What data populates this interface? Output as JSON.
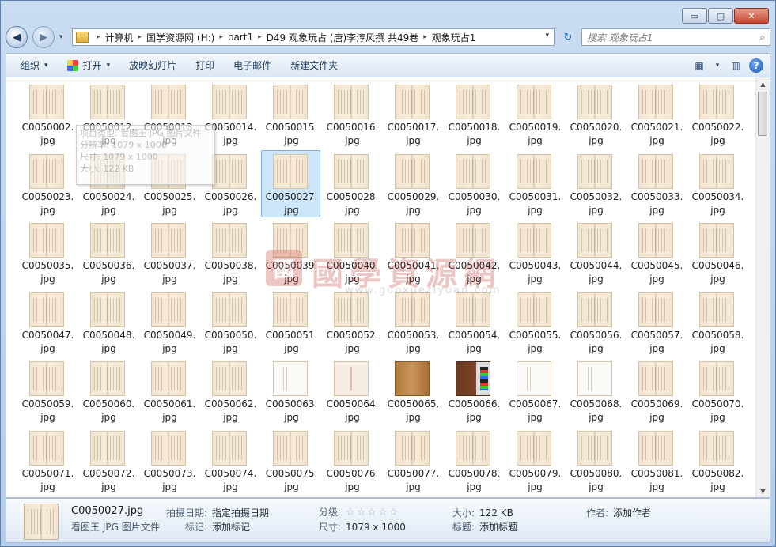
{
  "window": {
    "buttons": {
      "minimize": "▭",
      "maximize": "▢",
      "close": "✕"
    }
  },
  "nav": {
    "back": "◀",
    "forward": "▶",
    "recent": "▾"
  },
  "address": {
    "crumbs": [
      "计算机",
      "国学资源网 (H:)",
      "part1",
      "D49 观象玩占 (唐)李淳风撰 共49卷",
      "观象玩占1"
    ],
    "sep": "▸",
    "dropdown": "▾",
    "refresh": "↻"
  },
  "search": {
    "placeholder": "搜索 观象玩占1",
    "icon": "⌕"
  },
  "toolbar": {
    "organize": "组织",
    "open": "打开",
    "slideshow": "放映幻灯片",
    "print": "打印",
    "email": "电子邮件",
    "new_folder": "新建文件夹",
    "caret": "▾",
    "views_icon": "▦",
    "pane_icon": "▥",
    "help_icon": "?"
  },
  "tooltip": {
    "lines": [
      "项目类型: 看图王 JPG 图片文件",
      "分辨率: 1079 x 1000",
      "尺寸: 1079 x 1000",
      "大小: 122 KB"
    ]
  },
  "watermark": {
    "seal": "國",
    "text": "國學資源網",
    "url": "www.guoxueziyuan.com"
  },
  "files": [
    {
      "name": "C0050002.",
      "ext": "jpg"
    },
    {
      "name": "C0050012.",
      "ext": "jpg"
    },
    {
      "name": "C0050013.",
      "ext": "jpg"
    },
    {
      "name": "C0050014.",
      "ext": "jpg"
    },
    {
      "name": "C0050015.",
      "ext": "jpg"
    },
    {
      "name": "C0050016.",
      "ext": "jpg"
    },
    {
      "name": "C0050017.",
      "ext": "jpg"
    },
    {
      "name": "C0050018.",
      "ext": "jpg"
    },
    {
      "name": "C0050019.",
      "ext": "jpg"
    },
    {
      "name": "C0050020.",
      "ext": "jpg"
    },
    {
      "name": "C0050021.",
      "ext": "jpg"
    },
    {
      "name": "C0050022.",
      "ext": "jpg"
    },
    {
      "name": "C0050023.",
      "ext": "jpg"
    },
    {
      "name": "C0050024.",
      "ext": "jpg"
    },
    {
      "name": "C0050025.",
      "ext": "jpg"
    },
    {
      "name": "C0050026.",
      "ext": "jpg"
    },
    {
      "name": "C0050027.",
      "ext": "jpg"
    },
    {
      "name": "C0050028.",
      "ext": "jpg"
    },
    {
      "name": "C0050029.",
      "ext": "jpg"
    },
    {
      "name": "C0050030.",
      "ext": "jpg"
    },
    {
      "name": "C0050031.",
      "ext": "jpg"
    },
    {
      "name": "C0050032.",
      "ext": "jpg"
    },
    {
      "name": "C0050033.",
      "ext": "jpg"
    },
    {
      "name": "C0050034.",
      "ext": "jpg"
    },
    {
      "name": "C0050035.",
      "ext": "jpg"
    },
    {
      "name": "C0050036.",
      "ext": "jpg"
    },
    {
      "name": "C0050037.",
      "ext": "jpg"
    },
    {
      "name": "C0050038.",
      "ext": "jpg"
    },
    {
      "name": "C0050039.",
      "ext": "jpg"
    },
    {
      "name": "C0050040.",
      "ext": "jpg"
    },
    {
      "name": "C0050041.",
      "ext": "jpg"
    },
    {
      "name": "C0050042.",
      "ext": "jpg"
    },
    {
      "name": "C0050043.",
      "ext": "jpg"
    },
    {
      "name": "C0050044.",
      "ext": "jpg"
    },
    {
      "name": "C0050045.",
      "ext": "jpg"
    },
    {
      "name": "C0050046.",
      "ext": "jpg"
    },
    {
      "name": "C0050047.",
      "ext": "jpg"
    },
    {
      "name": "C0050048.",
      "ext": "jpg"
    },
    {
      "name": "C0050049.",
      "ext": "jpg"
    },
    {
      "name": "C0050050.",
      "ext": "jpg"
    },
    {
      "name": "C0050051.",
      "ext": "jpg"
    },
    {
      "name": "C0050052.",
      "ext": "jpg"
    },
    {
      "name": "C0050053.",
      "ext": "jpg"
    },
    {
      "name": "C0050054.",
      "ext": "jpg"
    },
    {
      "name": "C0050055.",
      "ext": "jpg"
    },
    {
      "name": "C0050056.",
      "ext": "jpg"
    },
    {
      "name": "C0050057.",
      "ext": "jpg"
    },
    {
      "name": "C0050058.",
      "ext": "jpg"
    },
    {
      "name": "C0050059.",
      "ext": "jpg"
    },
    {
      "name": "C0050060.",
      "ext": "jpg"
    },
    {
      "name": "C0050061.",
      "ext": "jpg"
    },
    {
      "name": "C0050062.",
      "ext": "jpg"
    },
    {
      "name": "C0050063.",
      "ext": "jpg"
    },
    {
      "name": "C0050064.",
      "ext": "jpg"
    },
    {
      "name": "C0050065.",
      "ext": "jpg"
    },
    {
      "name": "C0050066.",
      "ext": "jpg"
    },
    {
      "name": "C0050067.",
      "ext": "jpg"
    },
    {
      "name": "C0050068.",
      "ext": "jpg"
    },
    {
      "name": "C0050069.",
      "ext": "jpg"
    },
    {
      "name": "C0050070.",
      "ext": "jpg"
    },
    {
      "name": "C0050071.",
      "ext": "jpg"
    },
    {
      "name": "C0050072.",
      "ext": "jpg"
    },
    {
      "name": "C0050073.",
      "ext": "jpg"
    },
    {
      "name": "C0050074.",
      "ext": "jpg"
    },
    {
      "name": "C0050075.",
      "ext": "jpg"
    },
    {
      "name": "C0050076.",
      "ext": "jpg"
    },
    {
      "name": "C0050077.",
      "ext": "jpg"
    },
    {
      "name": "C0050078.",
      "ext": "jpg"
    },
    {
      "name": "C0050079.",
      "ext": "jpg"
    },
    {
      "name": "C0050080.",
      "ext": "jpg"
    },
    {
      "name": "C0050081.",
      "ext": "jpg"
    },
    {
      "name": "C0050082.",
      "ext": "jpg"
    }
  ],
  "selected_file": "C0050027.",
  "details": {
    "filename": "C0050027.jpg",
    "filetype": "看图王 JPG 图片文件",
    "date_taken_label": "拍摄日期:",
    "date_taken_value": "指定拍摄日期",
    "tags_label": "标记:",
    "tags_value": "添加标记",
    "rating_label": "分级:",
    "rating_stars": "☆☆☆☆☆",
    "dimensions_label": "尺寸:",
    "dimensions_value": "1079 x 1000",
    "size_label": "大小:",
    "size_value": "122 KB",
    "title_label": "标题:",
    "title_value": "添加标题",
    "author_label": "作者:",
    "author_value": "添加作者"
  }
}
